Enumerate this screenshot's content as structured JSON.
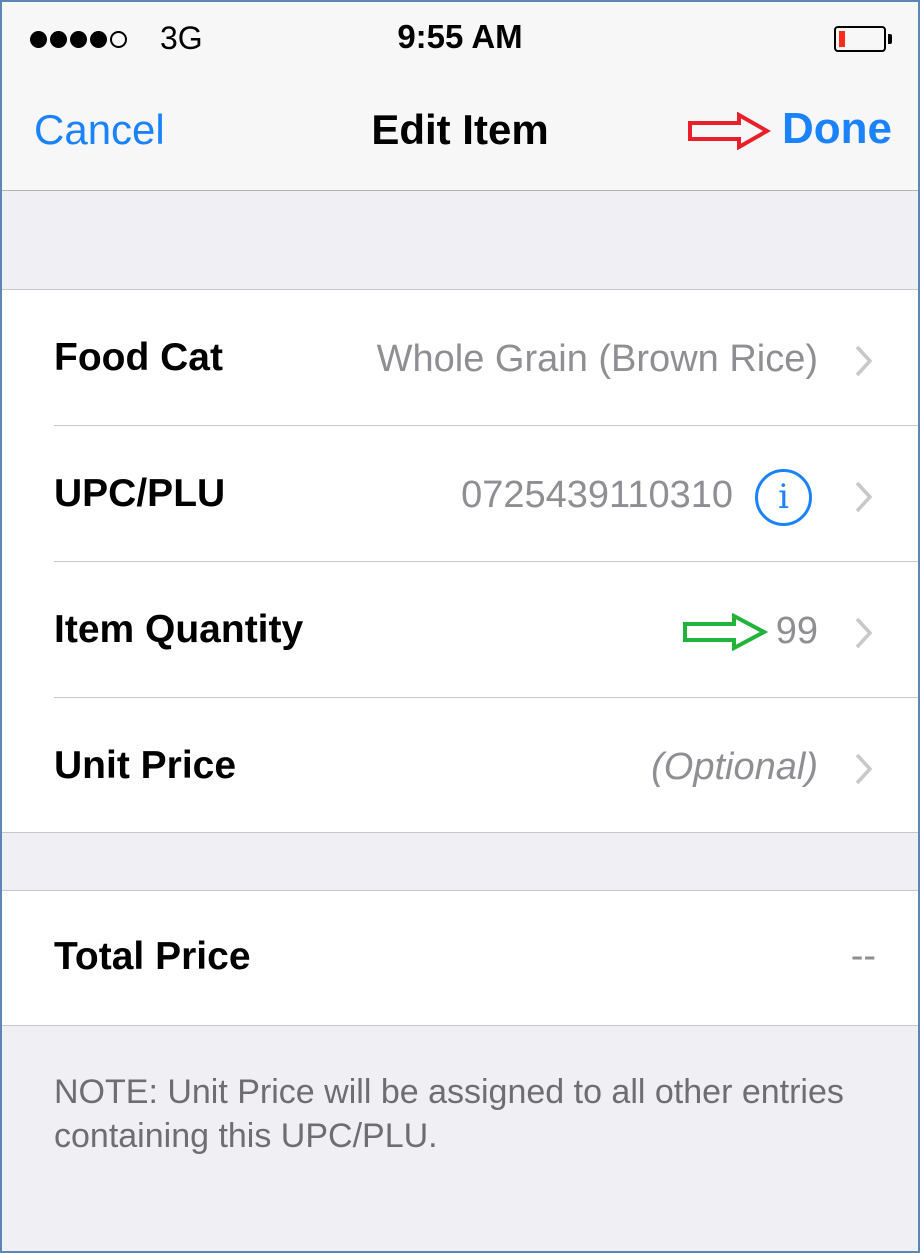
{
  "status_bar": {
    "carrier": "3G",
    "time": "9:55 AM",
    "signal_bars": 4,
    "signal_total": 5,
    "battery_level": 0.15,
    "battery_color": "#ff2a1a"
  },
  "nav": {
    "cancel_label": "Cancel",
    "title": "Edit Item",
    "done_label": "Done",
    "accent_color": "#1a82fb"
  },
  "rows": {
    "food_cat": {
      "label": "Food Cat",
      "value": "Whole Grain (Brown Rice)"
    },
    "upc": {
      "label": "UPC/PLU",
      "value": "0725439110310",
      "info_glyph": "i"
    },
    "quantity": {
      "label": "Item Quantity",
      "value": "99"
    },
    "unit_price": {
      "label": "Unit Price",
      "placeholder": "(Optional)"
    },
    "total_price": {
      "label": "Total Price",
      "value": "--"
    }
  },
  "note": "NOTE: Unit Price will be assigned to all other entries containing this UPC/PLU.",
  "annotations": {
    "red_arrow_color": "#e8202a",
    "green_arrow_color": "#22b33a"
  }
}
